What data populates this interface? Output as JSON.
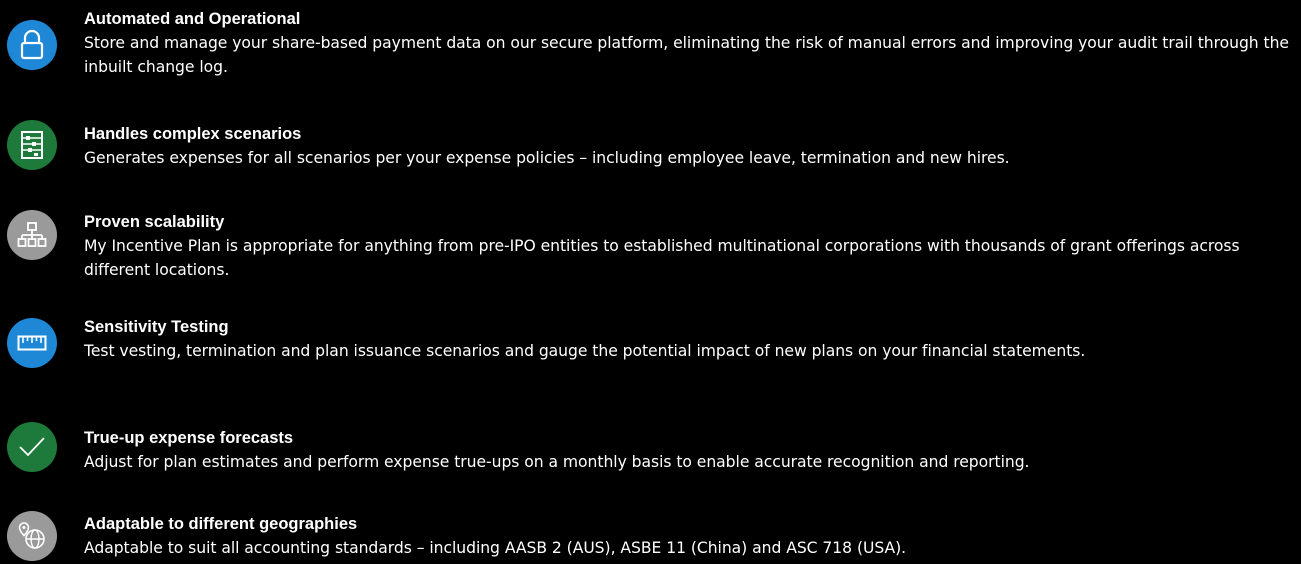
{
  "colors": {
    "background": "#000000",
    "text": "#ffffff",
    "icon_blue": "#1e88d6",
    "icon_green": "#1d7a3b",
    "icon_grey": "#9a9a9a",
    "icon_glyph": "#ffffff"
  },
  "features": [
    {
      "icon": "lock-icon",
      "title": "Automated and Operational",
      "description": "Store and manage your share-based payment data on our secure platform, eliminating the risk of manual errors and improving your audit trail through the inbuilt change log."
    },
    {
      "icon": "abacus-icon",
      "title": "Handles complex scenarios",
      "description": "Generates expenses for all scenarios per your expense policies – including employee leave, termination and new hires."
    },
    {
      "icon": "hierarchy-icon",
      "title": "Proven scalability",
      "description": "My Incentive Plan is appropriate for anything from pre-IPO entities to established multinational corporations with thousands of grant offerings across different locations."
    },
    {
      "icon": "ruler-icon",
      "title": "Sensitivity Testing",
      "description": "Test vesting, termination and plan issuance scenarios and gauge the potential impact of new plans on your financial statements."
    },
    {
      "icon": "checkmark-icon",
      "title": "True-up expense forecasts",
      "description": "Adjust for plan estimates and perform expense true-ups on a monthly basis to enable accurate recognition and reporting."
    },
    {
      "icon": "globe-location-icon",
      "title": "Adaptable to different geographies",
      "description": "Adaptable to suit all accounting standards – including AASB 2 (AUS), ASBE 11 (China) and ASC 718 (USA)."
    }
  ]
}
